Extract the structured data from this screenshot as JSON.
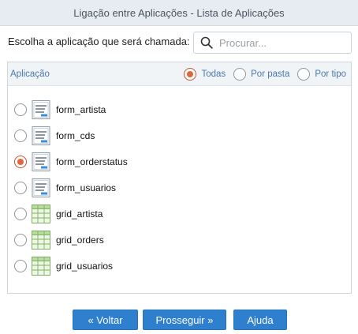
{
  "window": {
    "title": "Ligação entre Aplicações - Lista de Aplicações"
  },
  "chooser": {
    "label": "Escolha a aplicação que será chamada:"
  },
  "search": {
    "placeholder": "Procurar...",
    "icon": "search-icon"
  },
  "panel": {
    "column_title": "Aplicação",
    "filters": [
      {
        "label": "Todas",
        "selected": true
      },
      {
        "label": "Por pasta",
        "selected": false
      },
      {
        "label": "Por tipo",
        "selected": false
      }
    ]
  },
  "applications": [
    {
      "name": "form_artista",
      "type": "form",
      "icon": "form-icon",
      "selected": false
    },
    {
      "name": "form_cds",
      "type": "form",
      "icon": "form-icon",
      "selected": false
    },
    {
      "name": "form_orderstatus",
      "type": "form",
      "icon": "form-icon",
      "selected": true
    },
    {
      "name": "form_usuarios",
      "type": "form",
      "icon": "form-icon",
      "selected": false
    },
    {
      "name": "grid_artista",
      "type": "grid",
      "icon": "grid-icon",
      "selected": false
    },
    {
      "name": "grid_orders",
      "type": "grid",
      "icon": "grid-icon",
      "selected": false
    },
    {
      "name": "grid_usuarios",
      "type": "grid",
      "icon": "grid-icon",
      "selected": false
    }
  ],
  "buttons": {
    "back": "« Voltar",
    "next": "Prosseguir »",
    "help": "Ajuda"
  },
  "colors": {
    "accent_button": "#2f7fcf",
    "radio_selected": "#e0673a",
    "header_link": "#4a79a8"
  }
}
